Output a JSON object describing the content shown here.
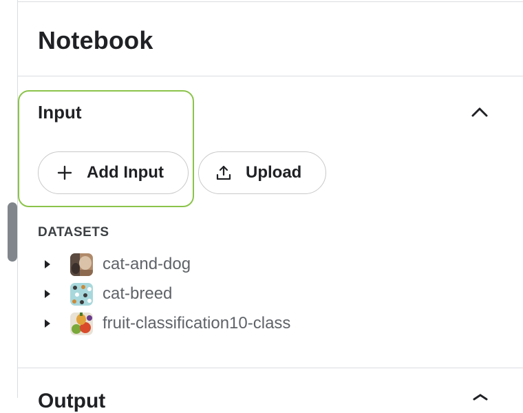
{
  "page": {
    "title": "Notebook"
  },
  "input_section": {
    "title": "Input",
    "collapse_icon": "chevron-up-icon",
    "add_input_label": "Add Input",
    "upload_label": "Upload",
    "highlight_color": "#8bc34a"
  },
  "datasets": {
    "header": "DATASETS",
    "items": [
      {
        "label": "cat-and-dog",
        "thumb_icon": "cat-and-dog-thumbnail"
      },
      {
        "label": "cat-breed",
        "thumb_icon": "cat-breed-thumbnail"
      },
      {
        "label": "fruit-classification10-class",
        "thumb_icon": "fruit-thumbnail"
      }
    ]
  },
  "next_section": {
    "title": "Output"
  }
}
